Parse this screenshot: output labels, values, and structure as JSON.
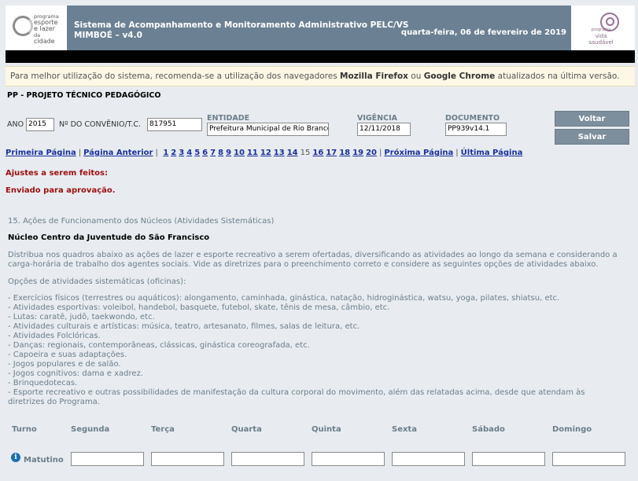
{
  "header": {
    "title": "Sistema de Acompanhamento e Monitoramento Administrativo PELC/VS MIMBOÉ – v4.0",
    "date": "quarta-feira, 06 de fevereiro de 2019",
    "logo_left_lines": [
      "programa",
      "esporte",
      "e lazer",
      "da",
      "cidade"
    ],
    "logo_right_lines": [
      "programa",
      "vida",
      "saudável"
    ],
    "band_color": "#6b8193"
  },
  "notice": {
    "prefix": "Para melhor utilização do sistema, recomenda-se a utilização dos navegadores ",
    "browser1": "Mozilla Firefox",
    "mid": " ou ",
    "browser2": "Google Chrome",
    "suffix": " atualizados na última versão."
  },
  "project_title": "PP - PROJETO TÉCNICO PEDAGÓGICO",
  "form": {
    "ano_label": "ANO",
    "ano_value": "2015",
    "convenio_label": "Nº DO CONVÊNIO/T.C.",
    "convenio_value": "817951",
    "entidade_label": "ENTIDADE",
    "entidade_value": "Prefeitura Municipal de Rio Branco",
    "vigencia_label": "VIGÊNCIA",
    "vigencia_value": "12/11/2018",
    "documento_label": "DOCUMENTO",
    "documento_value": "PP939v14.1",
    "voltar_label": "Voltar",
    "salvar_label": "Salvar"
  },
  "pager": {
    "first": "Primeira Página",
    "prev": "Página Anterior",
    "pages_before": [
      "1",
      "2",
      "3",
      "4",
      "5",
      "6",
      "7",
      "8",
      "9",
      "10",
      "11",
      "12",
      "13",
      "14"
    ],
    "current": "15",
    "pages_after": [
      "16",
      "17",
      "18",
      "19",
      "20"
    ],
    "next": "Próxima Página",
    "last": "Última Página",
    "separator": "|"
  },
  "status": {
    "adjustments": "Ajustes a serem feitos:",
    "sent": "Enviado para aprovação."
  },
  "section": {
    "title": "15. Ações de Funcionamento dos Núcleos (Atividades Sistemáticas)",
    "nucleo": "Núcleo Centro da Juventude do São Francisco",
    "description": "Distribua nos quadros abaixo as ações de lazer e esporte recreativo a serem ofertadas, diversificando as atividades ao longo da semana e considerando a carga-horária de trabalho dos agentes sociais. Vide as diretrizes para o preenchimento correto e considere as seguintes opções de atividades abaixo.",
    "options_title": "Opções de atividades sistemáticas (oficinas):",
    "options": [
      "- Exercícios físicos (terrestres ou aquáticos): alongamento, caminhada, ginástica, natação, hidroginástica, watsu, yoga, pilates, shiatsu, etc.",
      "- Atividades esportivas: voleibol, handebol, basquete, futebol, skate, tênis de mesa, câmbio, etc.",
      "- Lutas: caratê, judô, taekwondo, etc.",
      "- Atividades culturais e artísticas: música, teatro, artesanato, filmes, salas de leitura, etc.",
      "- Atividades Folclóricas.",
      "- Danças: regionais, contemporâneas, clássicas, ginástica coreografada, etc.",
      "- Capoeira e suas adaptações.",
      "- Jogos populares e de salão.",
      "- Jogos cognitivos: dama e xadrez.",
      "- Brinquedotecas.",
      "- Esporte recreativo e outras possibilidades de manifestação da cultura corporal do movimento, além das relatadas acima, desde que atendam às diretrizes do Programa."
    ]
  },
  "schedule": {
    "headers": [
      "Turno",
      "Segunda",
      "Terça",
      "Quarta",
      "Quinta",
      "Sexta",
      "Sábado",
      "Domingo"
    ],
    "rows": [
      {
        "turno": "Matutino",
        "icon": "info-icon"
      }
    ]
  }
}
